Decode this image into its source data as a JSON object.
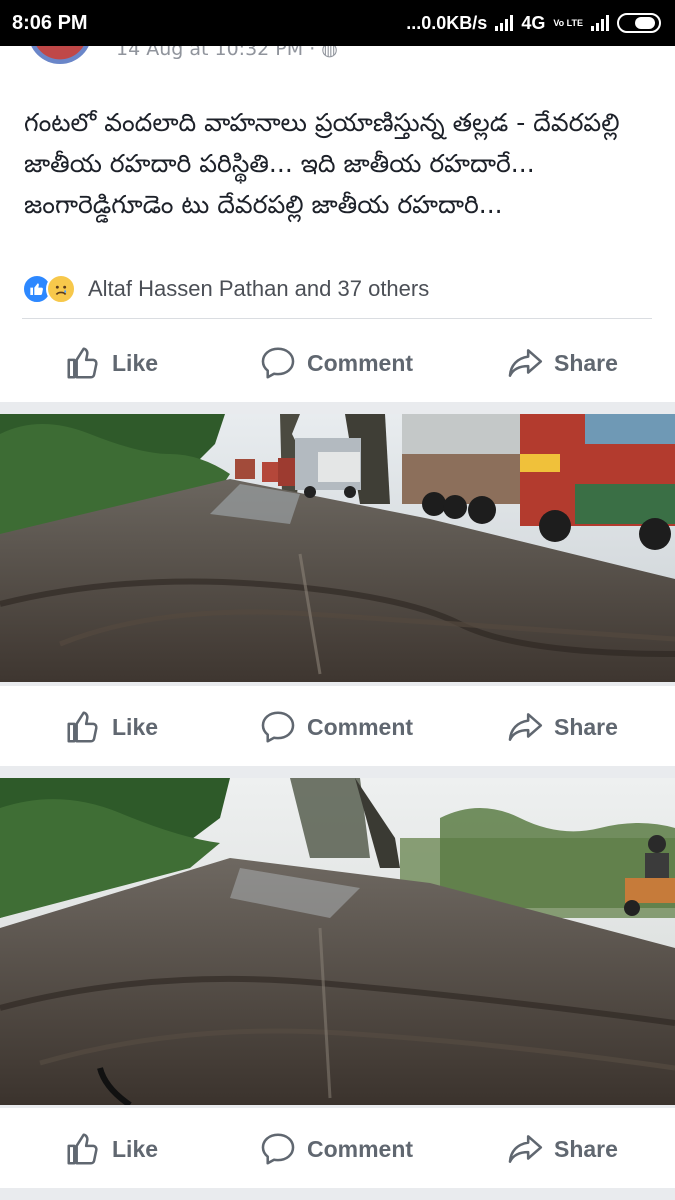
{
  "status_bar": {
    "time": "8:06 PM",
    "network_speed": "...0.0KB/s",
    "network_type": "4G",
    "volte": "Vo LTE",
    "icons": [
      "signal-icon",
      "volte-icon",
      "signal-icon",
      "battery-icon"
    ]
  },
  "post": {
    "timestamp": "14 Aug at 10:32 PM",
    "privacy_icon": "globe-icon",
    "text": "గంటలో వందలాది వాహనాలు ప్రయాణిస్తున్న తల్లడ - దేవరపల్లి జాతీయ రహదారి పరిస్థితి...      ఇది జాతీయ రహదారే... జంగారెడ్డిగూడెం టు దేవరపల్లి జాతీయ రహదారి...",
    "reactions": {
      "icons": [
        "like-reaction-icon",
        "sad-reaction-icon"
      ],
      "summary": "Altaf Hassen Pathan and 37 others"
    }
  },
  "actions": {
    "like_label": "Like",
    "comment_label": "Comment",
    "share_label": "Share"
  },
  "colors": {
    "status_bar_bg": "#000000",
    "card_bg": "#ffffff",
    "feed_bg": "#e9ebee",
    "action_text": "#606770",
    "like_reaction": "#2d88ff",
    "sad_reaction": "#f7c84b"
  }
}
